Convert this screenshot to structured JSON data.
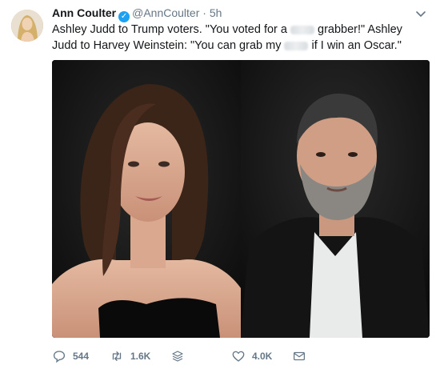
{
  "tweet": {
    "author": {
      "name": "Ann Coulter",
      "handle": "@AnnCoulter",
      "separator": "·",
      "time": "5h",
      "verified_icon": "verified-badge-icon"
    },
    "text": {
      "part1": "Ashley Judd to Trump voters. \"You voted for a",
      "part2": "grabber!\" Ashley Judd to Harvey Weinstein: \"You can grab my",
      "part3": "if I win an Oscar.\""
    },
    "media": {
      "left_photo": "photo-woman-black-dress",
      "right_photo": "photo-man-dark-suit"
    },
    "actions": {
      "replies": "544",
      "retweets": "1.6K",
      "likes": "4.0K"
    },
    "colors": {
      "accent": "#1da1f2",
      "muted": "#657786",
      "text": "#14171a"
    }
  }
}
